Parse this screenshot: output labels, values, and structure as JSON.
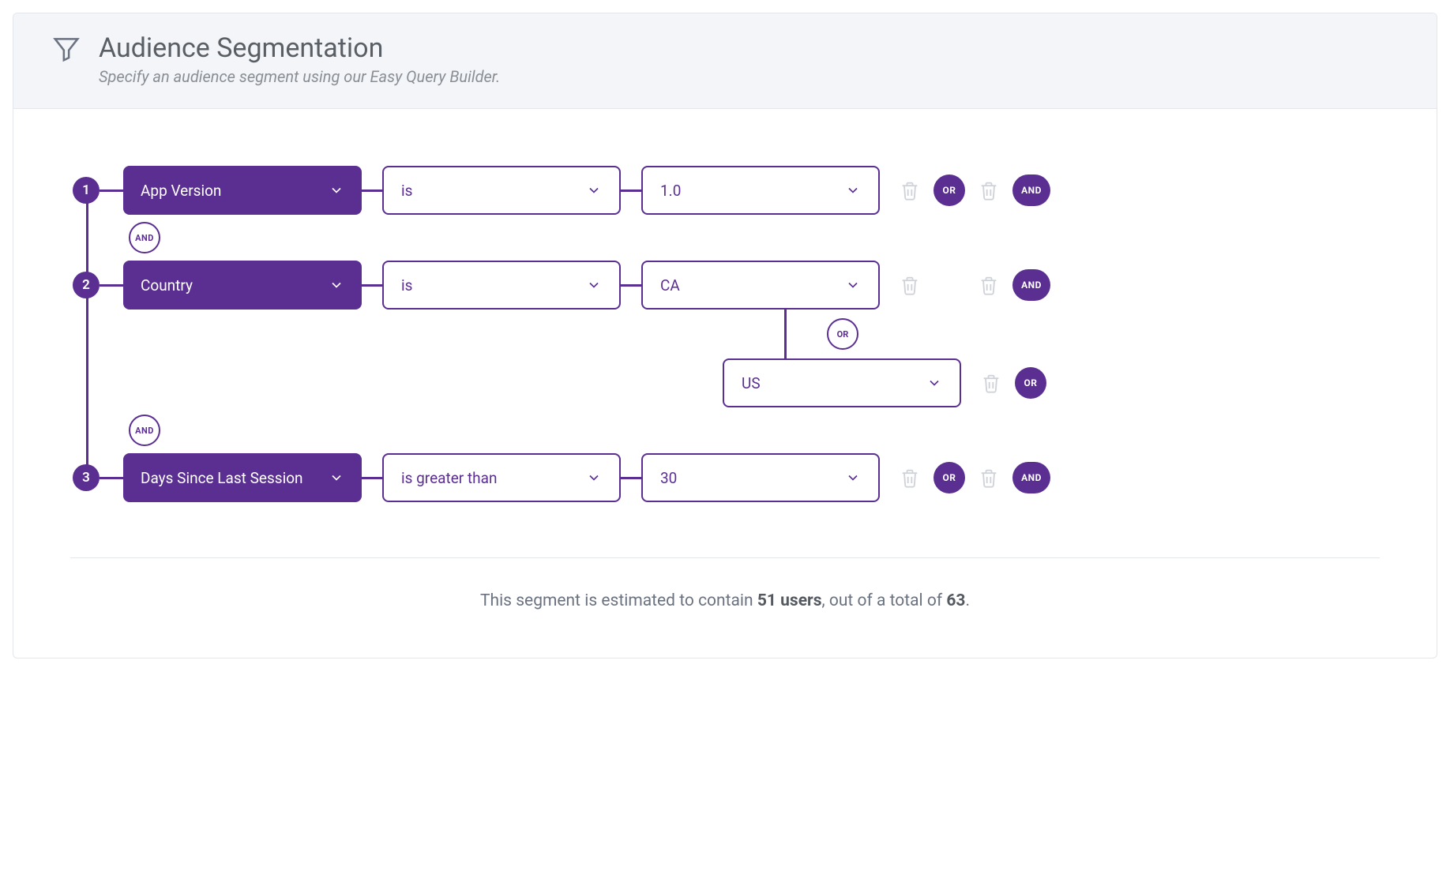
{
  "header": {
    "title": "Audience Segmentation",
    "subtitle": "Specify an audience segment using our Easy Query Builder."
  },
  "labels": {
    "and": "AND",
    "or": "OR"
  },
  "rules": [
    {
      "index": "1",
      "attribute": "App Version",
      "operator": "is",
      "values": [
        "1.0"
      ],
      "show_or_pill": true
    },
    {
      "index": "2",
      "attribute": "Country",
      "operator": "is",
      "values": [
        "CA",
        "US"
      ],
      "show_or_pill": false
    },
    {
      "index": "3",
      "attribute": "Days Since Last Session",
      "operator": "is greater than",
      "values": [
        "30"
      ],
      "show_or_pill": true
    }
  ],
  "footer": {
    "prefix": "This segment is estimated to contain ",
    "count": "51 users",
    "mid": ", out of a total of ",
    "total": "63",
    "suffix": "."
  }
}
